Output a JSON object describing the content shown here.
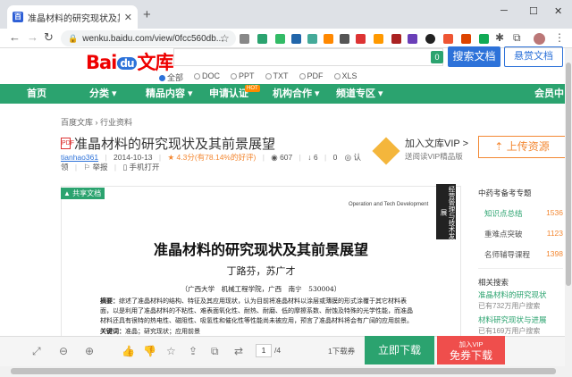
{
  "browser": {
    "tab_title": "准晶材料的研究现状及其前景展望",
    "url": "wenku.baidu.com/view/0fcc560db..."
  },
  "header": {
    "logo_bai": "Bai",
    "logo_du": "du",
    "logo_wenku": "文库",
    "badge": "0",
    "search_button": "搜索文档",
    "reward_button": "悬赏文档",
    "filters": [
      "全部",
      "DOC",
      "PPT",
      "TXT",
      "PDF",
      "XLS"
    ]
  },
  "nav": {
    "items": [
      "首页",
      "分类",
      "精品内容",
      "申请认证",
      "机构合作",
      "频道专区",
      "会员中"
    ],
    "hot": "HOT"
  },
  "doc": {
    "breadcrumb": "百度文库 › 行业资料",
    "title": "准晶材料的研究现状及其前景展望",
    "pdf_icon": "PDF",
    "author": "tianhao361",
    "date": "2014-10-13",
    "rating": "4.3分(有78.14%的好评)",
    "views": "607",
    "downloads": "6",
    "extra": "0",
    "extra_label": "认",
    "line2": "领",
    "report": "举报",
    "phone": "手机打开",
    "vip_title": "加入文库VIP >",
    "vip_sub": "送阅读VIP精品版",
    "upload_button": "上传资源",
    "share_tag": "共享文档",
    "journal_side": "经营管理与技术发展",
    "journal_header": "Operation and Tech Development",
    "paper_title": "准晶材料的研究现状及其前景展望",
    "paper_authors": "丁路芬，苏广才",
    "paper_affil": "（广西大学　机械工程学院，广西　南宁　530004）",
    "abstract_label": "摘要：",
    "abstract": "综述了准晶材料的结构、特征及其应用现状，认为目前将准晶材料以涂层或薄膜的形式涂覆于其它材料表面，以是利用了准晶材料的不粘性、难表面氧化性、耐热、耐磨、低的摩擦系数、耐蚀及特殊的光学性能，而准晶材料还具有很特的热电性、磁阻性、吸氢性和催化性等性能尚未被应用，预言了准晶材料将会有广阔的应用前景。",
    "keywords_label": "关键词：",
    "keywords": "准晶；研究现状；应用前景"
  },
  "right": {
    "exam_title": "中药考备考专题",
    "exam_rows": [
      {
        "label": "知识点总结",
        "num": "1536"
      },
      {
        "label": "重难点突破",
        "num": "1123"
      },
      {
        "label": "名师辅导课程",
        "num": "1398"
      }
    ],
    "related_title": "相关搜索",
    "related": [
      {
        "link": "准晶材料的研究现状",
        "sub": "已有732万用户搜索"
      },
      {
        "link": "材料研究现状与进展",
        "sub": "已有169万用户搜索"
      }
    ]
  },
  "bottom": {
    "page_current": "1",
    "page_total": "/4",
    "download_count": "1下载券",
    "download_button": "立即下载",
    "free_line1": "加入VIP",
    "free_line2": "免券下载"
  },
  "colors": {
    "green": "#2ba36f",
    "blue": "#2d72d9",
    "orange": "#f38833",
    "red": "#ef4e4c"
  }
}
